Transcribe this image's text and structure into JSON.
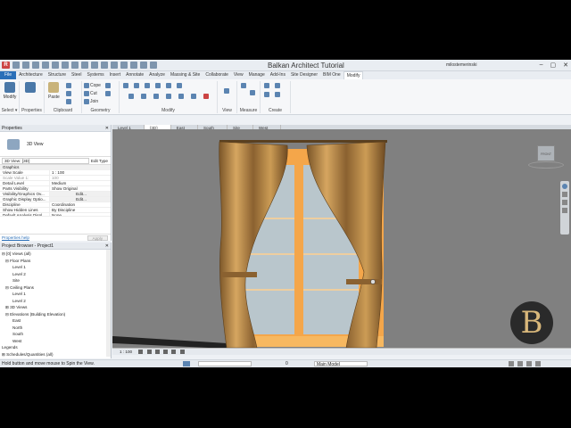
{
  "app": {
    "title": "Balkan Architect Tutorial",
    "user": "milostemerinski",
    "win_min": "–",
    "win_max": "▢",
    "win_close": "✕"
  },
  "ribbon_tabs": [
    "File",
    "Architecture",
    "Structure",
    "Steel",
    "Systems",
    "Insert",
    "Annotate",
    "Analyze",
    "Massing & Site",
    "Collaborate",
    "View",
    "Manage",
    "Add-Ins",
    "Site Designer",
    "BIM One",
    "Modify"
  ],
  "ribbon": {
    "modify_label": "Modify",
    "select_label": "Select ▾",
    "properties_label": "Properties",
    "clipboard_label": "Clipboard",
    "paste_label": "Paste",
    "cope_label": "Cope",
    "cut_label": "Cut",
    "join_label": "Join",
    "geometry_label": "Geometry",
    "modify_group_label": "Modify",
    "view_label": "View",
    "measure_label": "Measure",
    "create_label": "Create"
  },
  "properties": {
    "header": "Properties",
    "close": "✕",
    "type_name": "3D View",
    "selector": "3D View: {3D}",
    "edit_type": "Edit Type",
    "section": "Graphics",
    "rows": [
      {
        "label": "View Scale",
        "value": "1 : 100"
      },
      {
        "label": "Scale Value    1:",
        "value": "100"
      },
      {
        "label": "Detail Level",
        "value": "Medium"
      },
      {
        "label": "Parts Visibility",
        "value": "Show Original"
      },
      {
        "label": "Visibility/Graphics Ov...",
        "value": "Edit..."
      },
      {
        "label": "Graphic Display Optio...",
        "value": "Edit..."
      },
      {
        "label": "Discipline",
        "value": "Coordination"
      },
      {
        "label": "Show Hidden Lines",
        "value": "By Discipline"
      },
      {
        "label": "Default Analysis Displ...",
        "value": "None"
      }
    ],
    "help_link": "Properties help",
    "apply": "Apply"
  },
  "browser": {
    "header": "Project Browser - Project1",
    "close": "✕",
    "items": [
      {
        "label": "⊟ [0] Views (all)",
        "indent": 0
      },
      {
        "label": "⊟ Floor Plans",
        "indent": 1
      },
      {
        "label": "Level 1",
        "indent": 3
      },
      {
        "label": "Level 2",
        "indent": 3
      },
      {
        "label": "Site",
        "indent": 3
      },
      {
        "label": "⊟ Ceiling Plans",
        "indent": 1
      },
      {
        "label": "Level 1",
        "indent": 3
      },
      {
        "label": "Level 2",
        "indent": 3
      },
      {
        "label": "⊞ 3D Views",
        "indent": 1
      },
      {
        "label": "⊟ Elevations (Building Elevation)",
        "indent": 1
      },
      {
        "label": "East",
        "indent": 3
      },
      {
        "label": "North",
        "indent": 3
      },
      {
        "label": "South",
        "indent": 3
      },
      {
        "label": "West",
        "indent": 3
      },
      {
        "label": "Legends",
        "indent": 0
      },
      {
        "label": "⊞ Schedules/Quantities (all)",
        "indent": 0
      }
    ]
  },
  "view_tabs": [
    "Level 1",
    "{3D}",
    "East",
    "South",
    "Site",
    "West"
  ],
  "viewport": {
    "viewcube_label": "FRONT",
    "scale": "1 : 100",
    "watermark": "B"
  },
  "status": {
    "message": "Hold button and move mouse to Spin the View.",
    "count": "0",
    "model": "Main Model"
  },
  "colors": {
    "accent": "#2a6fb8",
    "viewport_bg": "#808080",
    "curtain": "#b88a48",
    "frame": "#f4a64a"
  }
}
